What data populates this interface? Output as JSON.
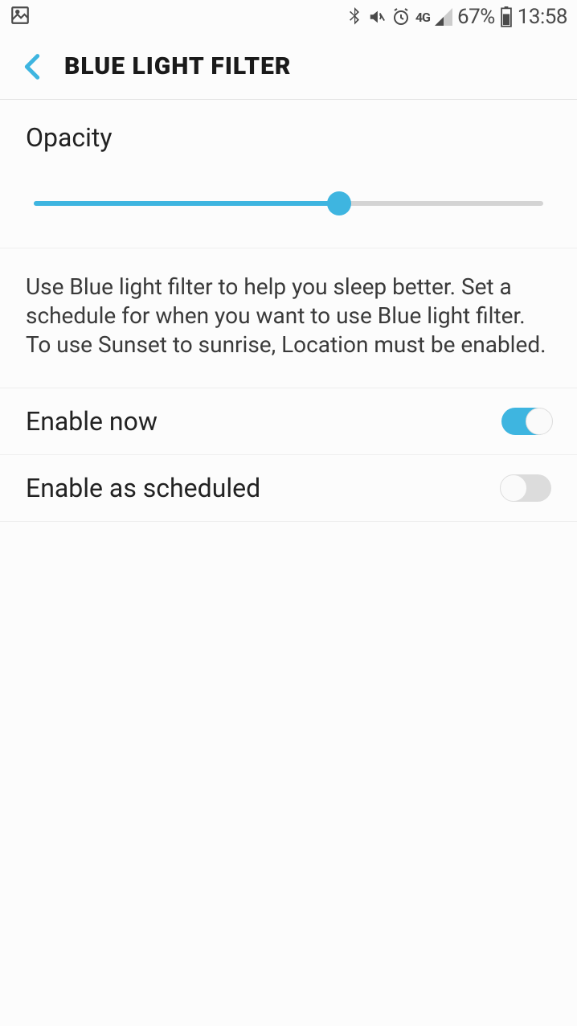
{
  "status_bar": {
    "battery_percent": "67%",
    "time": "13:58",
    "data_label": "4G"
  },
  "nav": {
    "title": "BLUE LIGHT FILTER"
  },
  "opacity": {
    "label": "Opacity",
    "value_percent": 60
  },
  "description": "Use Blue light filter to help you sleep better. Set a schedule for when you want to use Blue light filter. To use Sunset to sunrise, Location must be enabled.",
  "settings": {
    "enable_now": {
      "label": "Enable now",
      "on": true
    },
    "enable_scheduled": {
      "label": "Enable as scheduled",
      "on": false
    }
  }
}
